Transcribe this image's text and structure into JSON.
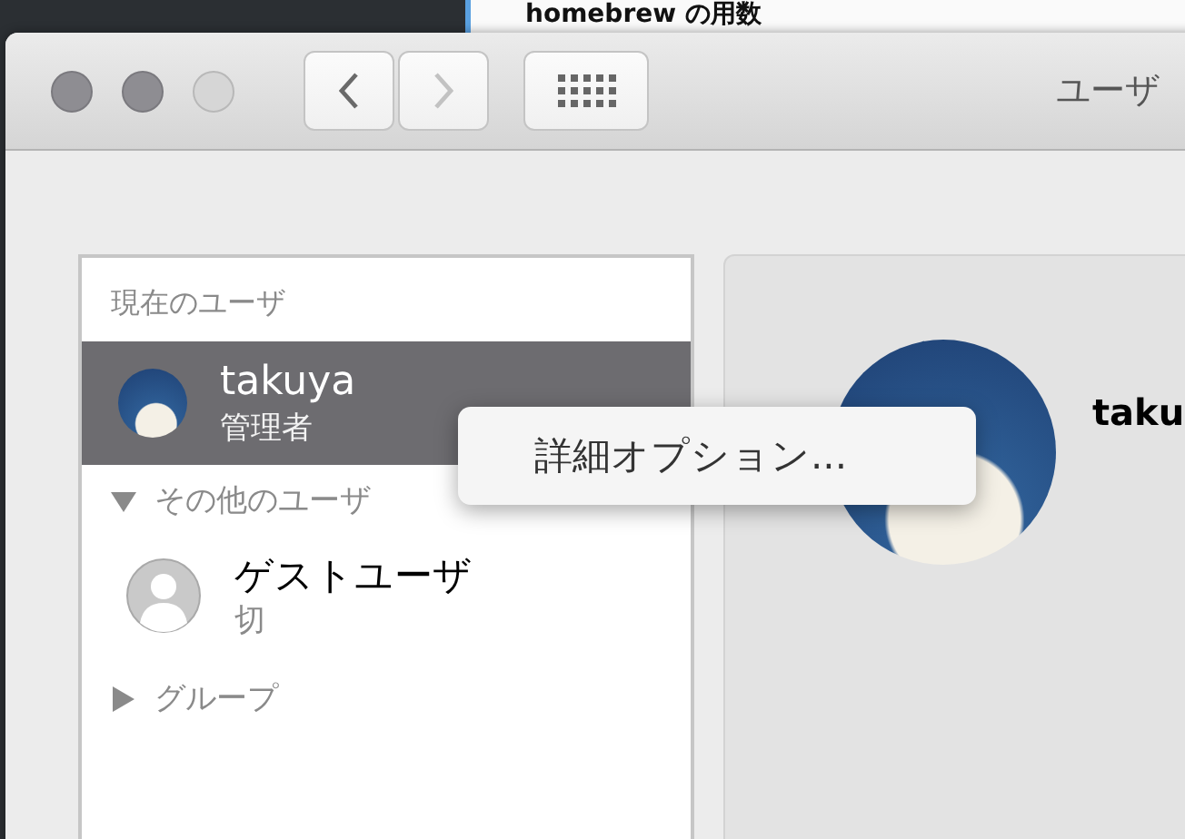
{
  "background_window": {
    "heading": "homebrew の用数"
  },
  "window": {
    "title": "ユーザ",
    "controls": [
      {
        "disabled": false
      },
      {
        "disabled": false
      },
      {
        "disabled": true
      }
    ],
    "navigation": [
      {
        "kind": "back",
        "disabled": false
      },
      {
        "kind": "forward",
        "disabled": true
      }
    ]
  },
  "sidebar": {
    "sections": [
      {
        "kind": "header",
        "label": "現在のユーザ",
        "users": [
          {
            "name": "takuya",
            "role": "管理者",
            "kind": "photo",
            "selected": true
          }
        ]
      },
      {
        "kind": "disclosure",
        "label": "その他のユーザ",
        "expanded": true,
        "users": [
          {
            "name": "ゲストユーザ",
            "role": "切",
            "kind": "guest",
            "selected": false
          }
        ]
      },
      {
        "kind": "disclosure",
        "label": "グループ",
        "expanded": false
      }
    ]
  },
  "detail": {
    "name": "taku"
  },
  "context_menu": {
    "items": [
      {
        "label": "詳細オプション..."
      }
    ]
  }
}
